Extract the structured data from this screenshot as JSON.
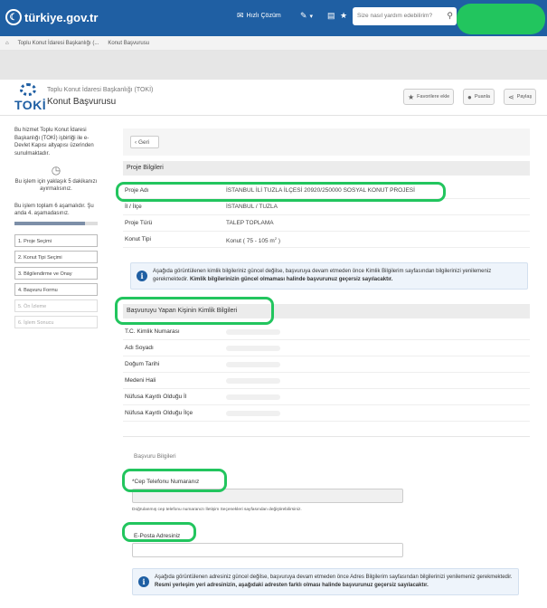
{
  "topbar": {
    "logo": "türkiye.gov.tr",
    "help_label": "Hızlı Çözüm",
    "search_placeholder": "Size nasıl yardım edebilirim?"
  },
  "breadcrumb": [
    "Toplu Konut İdaresi Başkanlığı (...",
    "Konut Başvurusu"
  ],
  "header": {
    "agency": "Toplu Konut İdaresi Başkanlığı (TOKİ)",
    "service_title": "Konut Başvurusu",
    "toki_logo": "TOKİ",
    "favorite_label": "Favorilere ekle",
    "comment_label": "Puanla",
    "share_label": "Paylaş"
  },
  "sidebar": {
    "intro": "Bu hizmet Toplu Konut İdaresi Başkanlığı (TOKİ) işbirliği ile e-Devlet Kapısı altyapısı üzerinden sunulmaktadır.",
    "time_note": "Bu işlem için yaklaşık 5 dakikanızı ayırmalısınız.",
    "progress_note": "Bu işlem toplam 6 aşamalıdır. Şu anda 4. aşamadasınız.",
    "progress_fraction": 0.85,
    "steps": [
      "1. Proje Seçimi",
      "2. Konut Tipi Seçimi",
      "3. Bilgilendirme ve Onay",
      "4. Başvuru Formu",
      "5. Ön İzleme",
      "6. İşlem Sonucu"
    ]
  },
  "main": {
    "back_label": "Geri",
    "project_section": "Proje Bilgileri",
    "project_rows": [
      {
        "key": "Proje Adı",
        "value": "İSTANBUL İLİ TUZLA İLÇESİ 20920/250000 SOSYAL KONUT PROJESİ"
      },
      {
        "key": "İl / İlçe",
        "value": "İSTANBUL / TUZLA"
      },
      {
        "key": "Proje Türü",
        "value": "TALEP TOPLAMA"
      },
      {
        "key": "Konut Tipi",
        "value": "Konut ( 75 - 105 m"
      }
    ],
    "unit_sup": "2",
    "unit_close": " )",
    "info1_text": "Aşağıda görüntülenen kimlik bilgileriniz güncel değilse, başvuruya devam etmeden önce Kimlik Bilgilerim sayfasından bilgilerinizi yenilemeniz gerekmektedir. ",
    "info1_bold": "Kimlik bilgilerinizin güncel olmaması halinde başvurunuz geçersiz sayılacaktır.",
    "identity_section": "Başvuruyu Yapan Kişinin Kimlik Bilgileri",
    "identity_rows": [
      "T.C. Kimlik Numarası",
      "Adı Soyadı",
      "Doğum Tarihi",
      "Medeni Hali",
      "Nüfusa Kayıtlı Olduğu İl",
      "Nüfusa Kayıtlı Olduğu İlçe"
    ],
    "application_section": "Başvuru Bilgileri",
    "phone_label": "*Cep Telefonu Numaranız",
    "phone_hint": "Doğrulanmış cep telefonu numaranızı İletişim Seçenekleri sayfasından değiştirebilirsiniz.",
    "email_label": "E-Posta Adresiniz",
    "info2_text": "Aşağıda görüntülenen adresiniz güncel değilse, başvuruya devam etmeden önce Adres Bilgilerim sayfasından bilgilerinizi yenilemeniz gerekmektedir. ",
    "info2_bold": "Resmi yerleşim yeri adresinizin, aşağıdaki adresten farklı olması halinde başvurunuz geçersiz sayılacaktır."
  },
  "colors": {
    "brand": "#1f5fa3",
    "highlight": "#22c55e"
  }
}
